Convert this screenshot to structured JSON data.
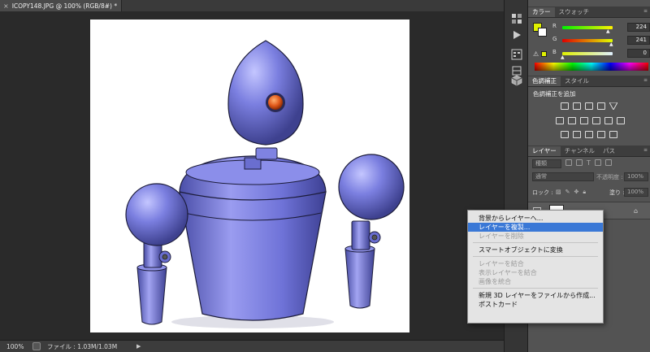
{
  "document": {
    "tab_title": "ICOPY148.JPG @ 100% (RGB/8#) *",
    "close_glyph": "×"
  },
  "status": {
    "zoom": "100%",
    "file": "ファイル : 1.03M/1.03M",
    "arrow": "▶"
  },
  "color_panel": {
    "tabs": [
      "カラー",
      "スウォッチ"
    ],
    "channels": [
      {
        "label": "R",
        "value": "224"
      },
      {
        "label": "G",
        "value": "241"
      },
      {
        "label": "B",
        "value": "0"
      }
    ],
    "fg_color": "#e0f100",
    "bg_color": "#ffffff"
  },
  "adjustments_panel": {
    "tabs": [
      "色調補正",
      "スタイル"
    ],
    "add_label": "色調補正を追加"
  },
  "layers_panel": {
    "tabs": [
      "レイヤー",
      "チャンネル",
      "パス"
    ],
    "filter_kind": "種類",
    "blend_mode": "通常",
    "opacity_label": "不透明度 :",
    "opacity_value": "100%",
    "lock_label": "ロック :",
    "fill_label": "塗り :",
    "fill_value": "100%"
  },
  "context_menu": {
    "group1": [
      {
        "label": "背景からレイヤーへ...",
        "state": "normal"
      },
      {
        "label": "レイヤーを複製...",
        "state": "highlight"
      },
      {
        "label": "レイヤーを削除",
        "state": "disabled"
      }
    ],
    "group2": [
      {
        "label": "スマートオブジェクトに変換",
        "state": "normal"
      }
    ],
    "group3": [
      {
        "label": "レイヤーを結合",
        "state": "disabled"
      },
      {
        "label": "表示レイヤーを結合",
        "state": "disabled"
      },
      {
        "label": "画像を統合",
        "state": "disabled"
      }
    ],
    "group4": [
      {
        "label": "新規 3D レイヤーをファイルから作成...",
        "state": "normal"
      },
      {
        "label": "ポストカード",
        "state": "normal"
      }
    ]
  },
  "colors": {
    "robot_body": "#7b7fe0",
    "robot_eye": "#e0581a",
    "menu_highlight": "#3a78d6"
  }
}
